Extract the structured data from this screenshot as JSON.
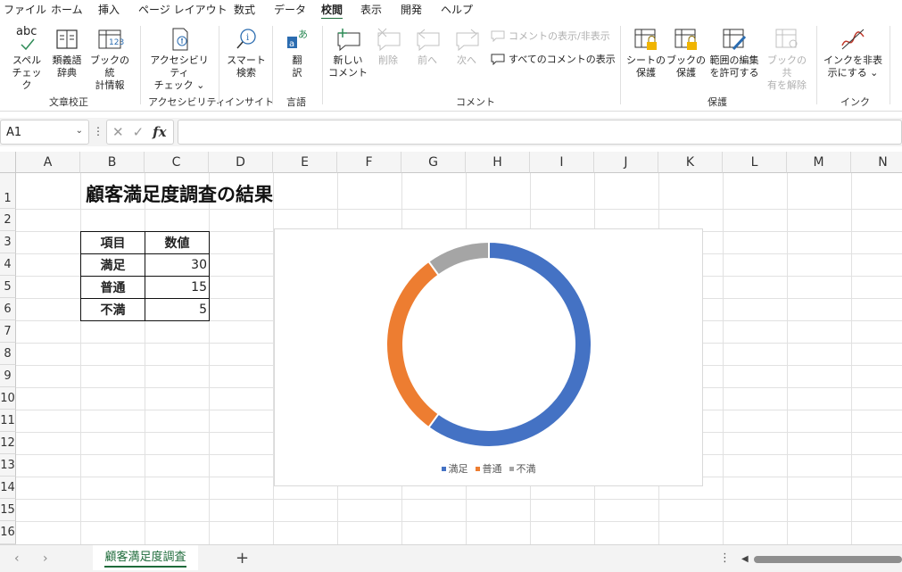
{
  "menubar": {
    "items": [
      "ファイル",
      "ホーム",
      "挿入",
      "ページ レイアウト",
      "数式",
      "データ",
      "校閲",
      "表示",
      "開発",
      "ヘルプ"
    ],
    "active_index": 6
  },
  "ribbon": {
    "spelling": "スペル\nチェック",
    "spelling_icon_text": "abc",
    "thesaurus": "類義語\n辞典",
    "workbook_stats": "ブックの統\n計情報",
    "workbook_stats_icon_text": "123",
    "accessibility": "アクセシビリティ\nチェック ⌄",
    "smart_lookup": "スマート\n検索",
    "translate": "翻\n訳",
    "new_comment": "新しい\nコメント",
    "delete": "削除",
    "previous": "前へ",
    "next": "次へ",
    "show_hide_comment": "コメントの表示/非表示",
    "show_all_comments": "すべてのコメントの表示",
    "protect_sheet": "シートの\n保護",
    "protect_workbook": "ブックの\n保護",
    "allow_edit_ranges": "範囲の編集\nを許可する",
    "unshare_workbook": "ブックの共\n有を解除",
    "hide_ink": "インクを非表\n示にする ⌄",
    "groups": {
      "proofing": "文章校正",
      "accessibility": "アクセシビリティ",
      "insights": "インサイト",
      "language": "言語",
      "comments": "コメント",
      "protect": "保護",
      "ink": "インク"
    }
  },
  "formula_bar": {
    "name_box": "A1",
    "fx": "fx",
    "formula": ""
  },
  "grid": {
    "columns": [
      "A",
      "B",
      "C",
      "D",
      "E",
      "F",
      "G",
      "H",
      "I",
      "J",
      "K",
      "L",
      "M",
      "N"
    ],
    "rows": [
      "1",
      "2",
      "3",
      "4",
      "5",
      "6",
      "7",
      "8",
      "9",
      "10",
      "11",
      "12",
      "13",
      "14",
      "15",
      "16"
    ]
  },
  "sheet": {
    "title": "顧客満足度調査の結果",
    "table_headers": [
      "項目",
      "数値"
    ],
    "table_rows": [
      {
        "label": "満足",
        "value": "30"
      },
      {
        "label": "普通",
        "value": "15"
      },
      {
        "label": "不満",
        "value": "5"
      }
    ]
  },
  "chart_data": {
    "type": "pie",
    "variant": "doughnut",
    "categories": [
      "満足",
      "普通",
      "不満"
    ],
    "values": [
      30,
      15,
      5
    ],
    "colors": [
      "#4472c4",
      "#ed7d31",
      "#a5a5a5"
    ],
    "legend": "bottom"
  },
  "tabs": {
    "sheet_name": "顧客満足度調査",
    "add": "+",
    "more": "⋮"
  },
  "colors": {
    "accent": "#1e6b3a"
  }
}
